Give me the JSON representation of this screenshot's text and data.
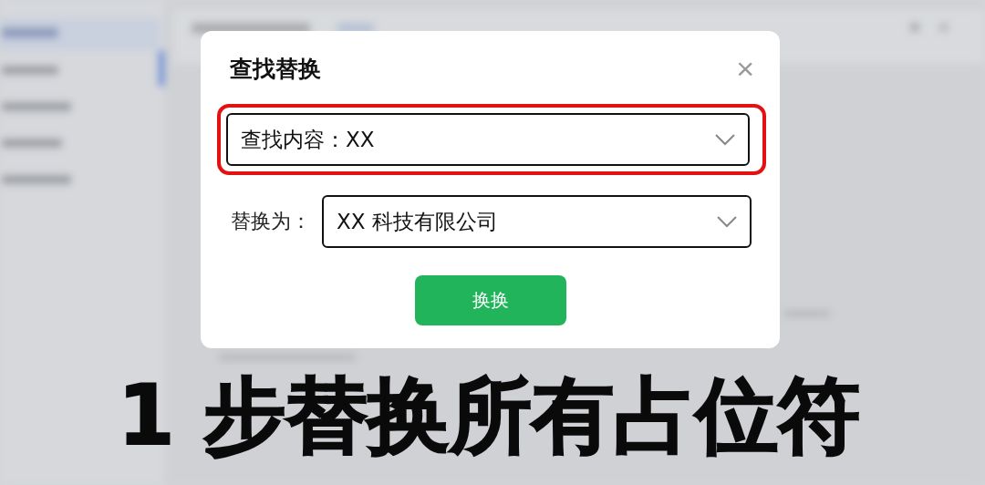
{
  "dialog": {
    "title": "查找替换",
    "close": "×",
    "fields": [
      {
        "kind": "inline",
        "label": "查找内容：",
        "value": "XX",
        "highlighted": true
      },
      {
        "kind": "outside",
        "label": "替换为：",
        "value": "XX 科技有限公司",
        "highlighted": false
      }
    ],
    "button": "换换"
  },
  "caption": "1 步替换所有占位符"
}
